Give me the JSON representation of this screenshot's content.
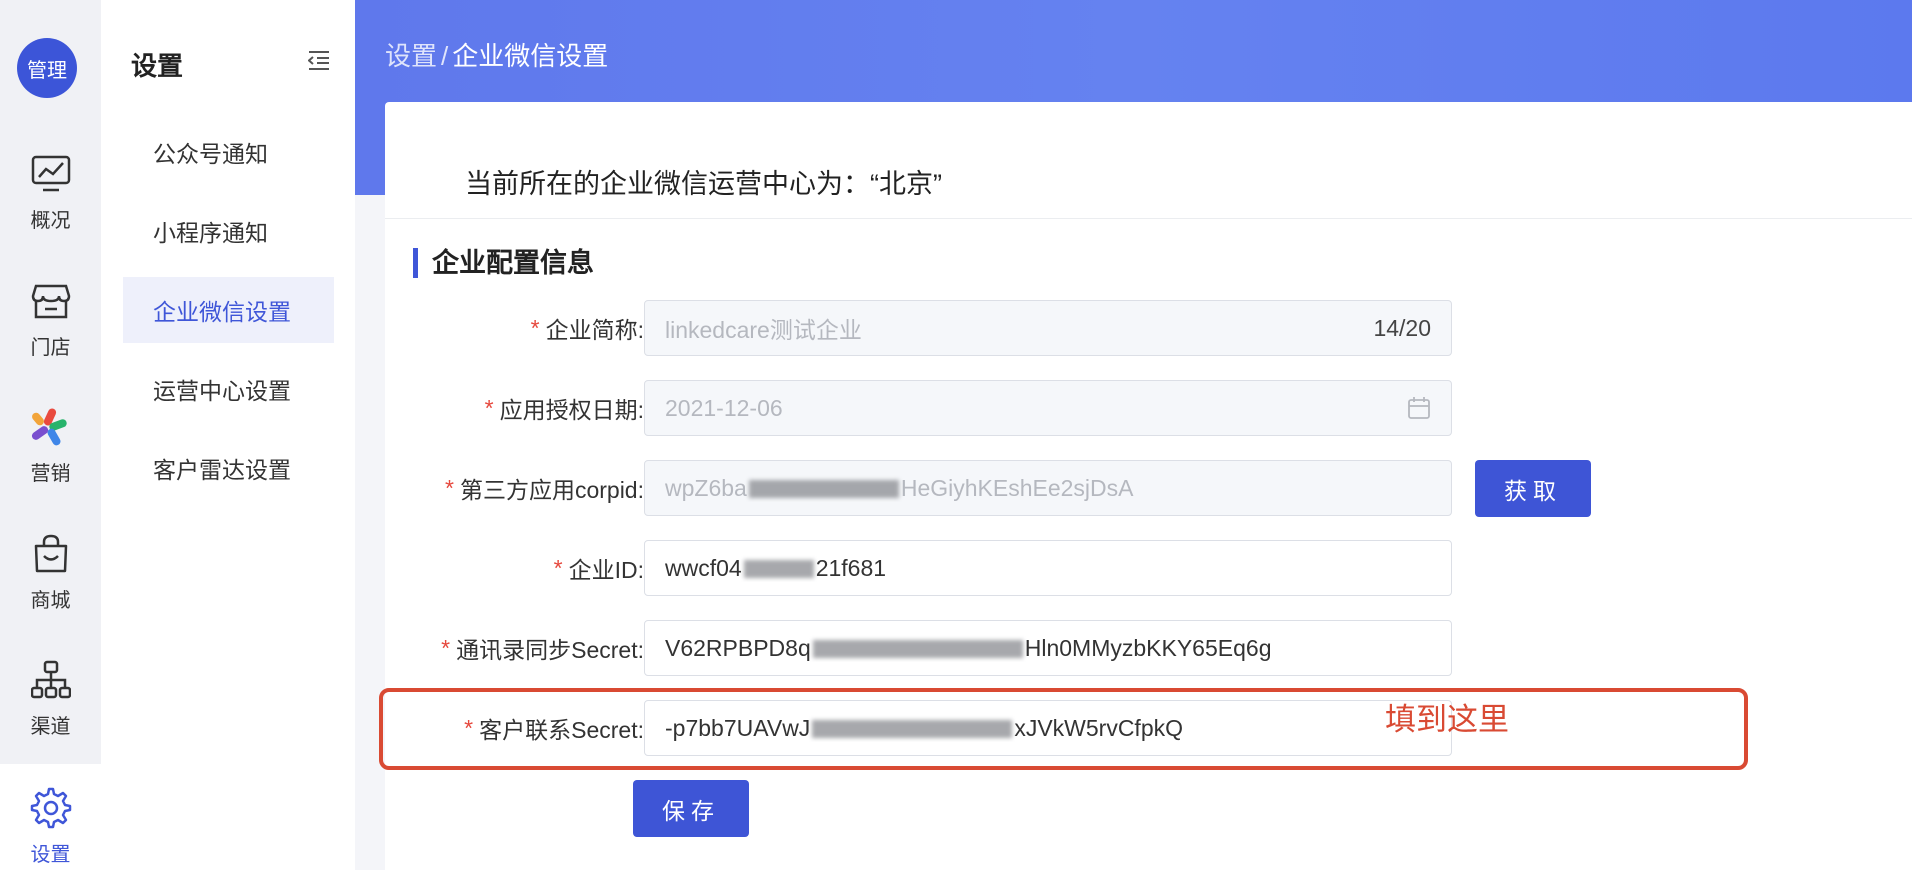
{
  "rail": {
    "avatar": "管理",
    "items": [
      {
        "label": "概况",
        "icon": "chart-icon"
      },
      {
        "label": "门店",
        "icon": "store-icon"
      },
      {
        "label": "营销",
        "icon": "marketing-icon"
      },
      {
        "label": "商城",
        "icon": "shopping-bag-icon"
      },
      {
        "label": "渠道",
        "icon": "channel-tree-icon"
      },
      {
        "label": "设置",
        "icon": "gear-icon",
        "active": true
      }
    ]
  },
  "submenu": {
    "title": "设置",
    "items": [
      "公众号通知",
      "小程序通知",
      "企业微信设置",
      "运营中心设置",
      "客户雷达设置"
    ],
    "active_index": 2
  },
  "breadcrumb": {
    "parent": "设置",
    "separator": "/",
    "current": "企业微信设置"
  },
  "center_line": "当前所在的企业微信运营中心为：“北京”",
  "section_title": "企业配置信息",
  "form": {
    "required_mark": "*",
    "company_name": {
      "label": "企业简称:",
      "value": "linkedcare测试企业",
      "counter": "14/20"
    },
    "auth_date": {
      "label": "应用授权日期:",
      "value": "2021-12-06"
    },
    "corpid": {
      "label": "第三方应用corpid:",
      "value_start": "wpZ6ba",
      "value_end": "HeGiyhKEshEe2sjDsA",
      "button": "获取"
    },
    "corp_id": {
      "label": "企业ID:",
      "value_start": "wwcf04",
      "value_end": "21f681"
    },
    "contacts_secret": {
      "label": "通讯录同步Secret:",
      "value_start": "V62RPBPD8q",
      "value_end": "Hln0MMyzbKKY65Eq6g"
    },
    "customer_secret": {
      "label": "客户联系Secret:",
      "value_start": "-p7bb7UAVwJ",
      "value_end": "xJVkW5rvCfpkQ"
    }
  },
  "save_button": "保存",
  "annotation": "填到这里",
  "colors": {
    "primary": "#3e55d6",
    "banner": "#6582f0",
    "required": "#e6483d",
    "annotation": "#d94a33"
  }
}
